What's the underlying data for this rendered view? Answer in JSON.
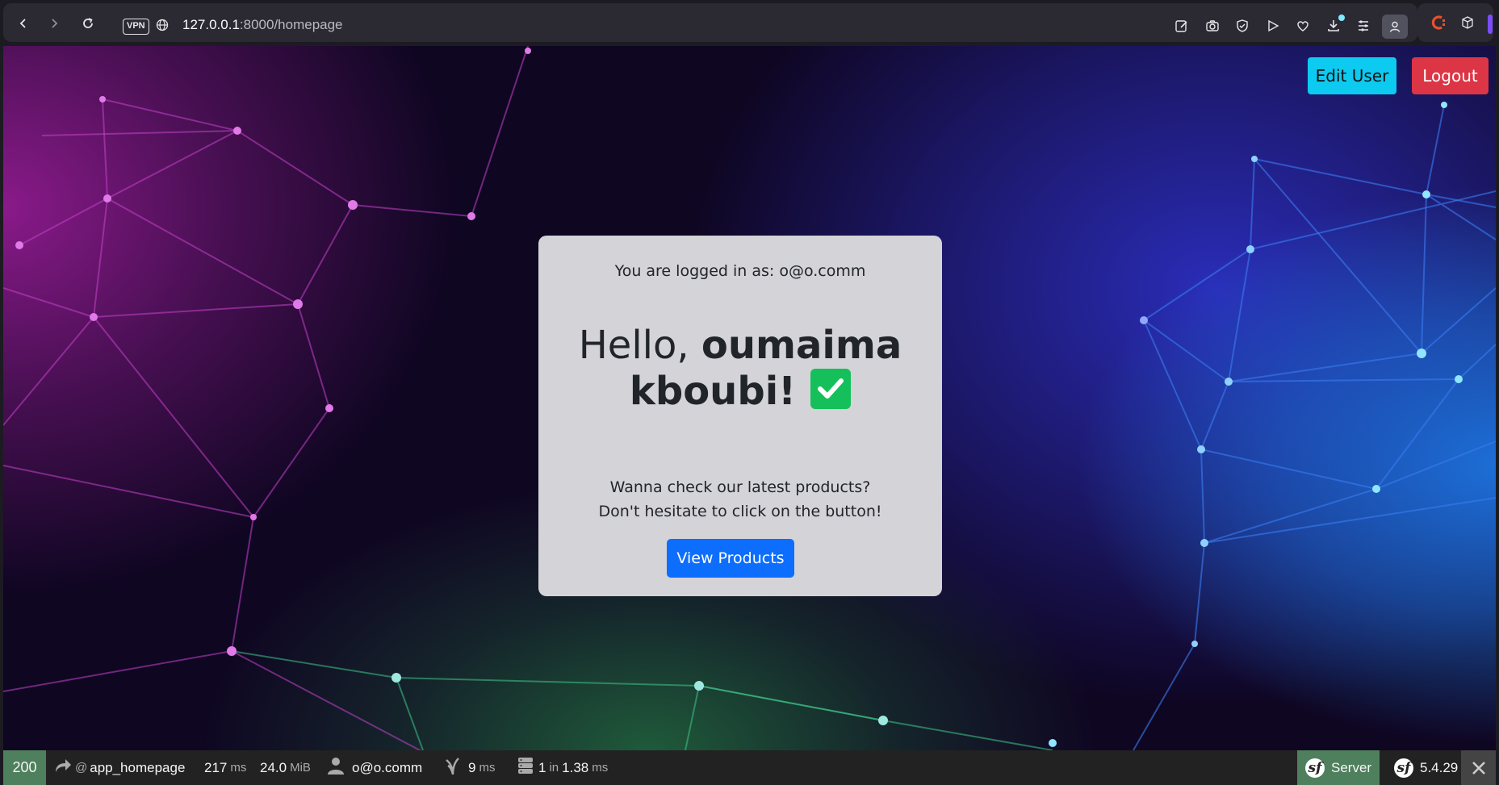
{
  "browser": {
    "vpn_label": "VPN",
    "url_host": "127.0.0.1",
    "url_path": ":8000/homepage"
  },
  "header": {
    "edit_user_label": "Edit User",
    "logout_label": "Logout"
  },
  "card": {
    "logged_in_text": "You are logged in as: o@o.comm",
    "greeting": "Hello,",
    "user_name_line1": "oumaima",
    "user_name_line2": "kboubi!",
    "prompt_line1": "Wanna check our latest products?",
    "prompt_line2": "Don't hesitate to click on the button!",
    "view_products_label": "View Products"
  },
  "profiler_toolbar": {
    "status_code": "200",
    "route_prefix": "@",
    "route": "app_homepage",
    "time_value": "217",
    "time_unit": "ms",
    "memory_value": "24.0",
    "memory_unit": "MiB",
    "user": "o@o.comm",
    "twig_value": "9",
    "twig_unit": "ms",
    "db_count": "1",
    "db_in": "in",
    "db_time": "1.38",
    "db_unit": "ms",
    "server_label": "Server",
    "version": "5.4.29"
  },
  "colors": {
    "edit_button": "#0dcaf0",
    "logout_button": "#dc3545",
    "view_products_button": "#0d6efd",
    "status_ok": "#4f805d",
    "check_badge": "#15c05a"
  }
}
